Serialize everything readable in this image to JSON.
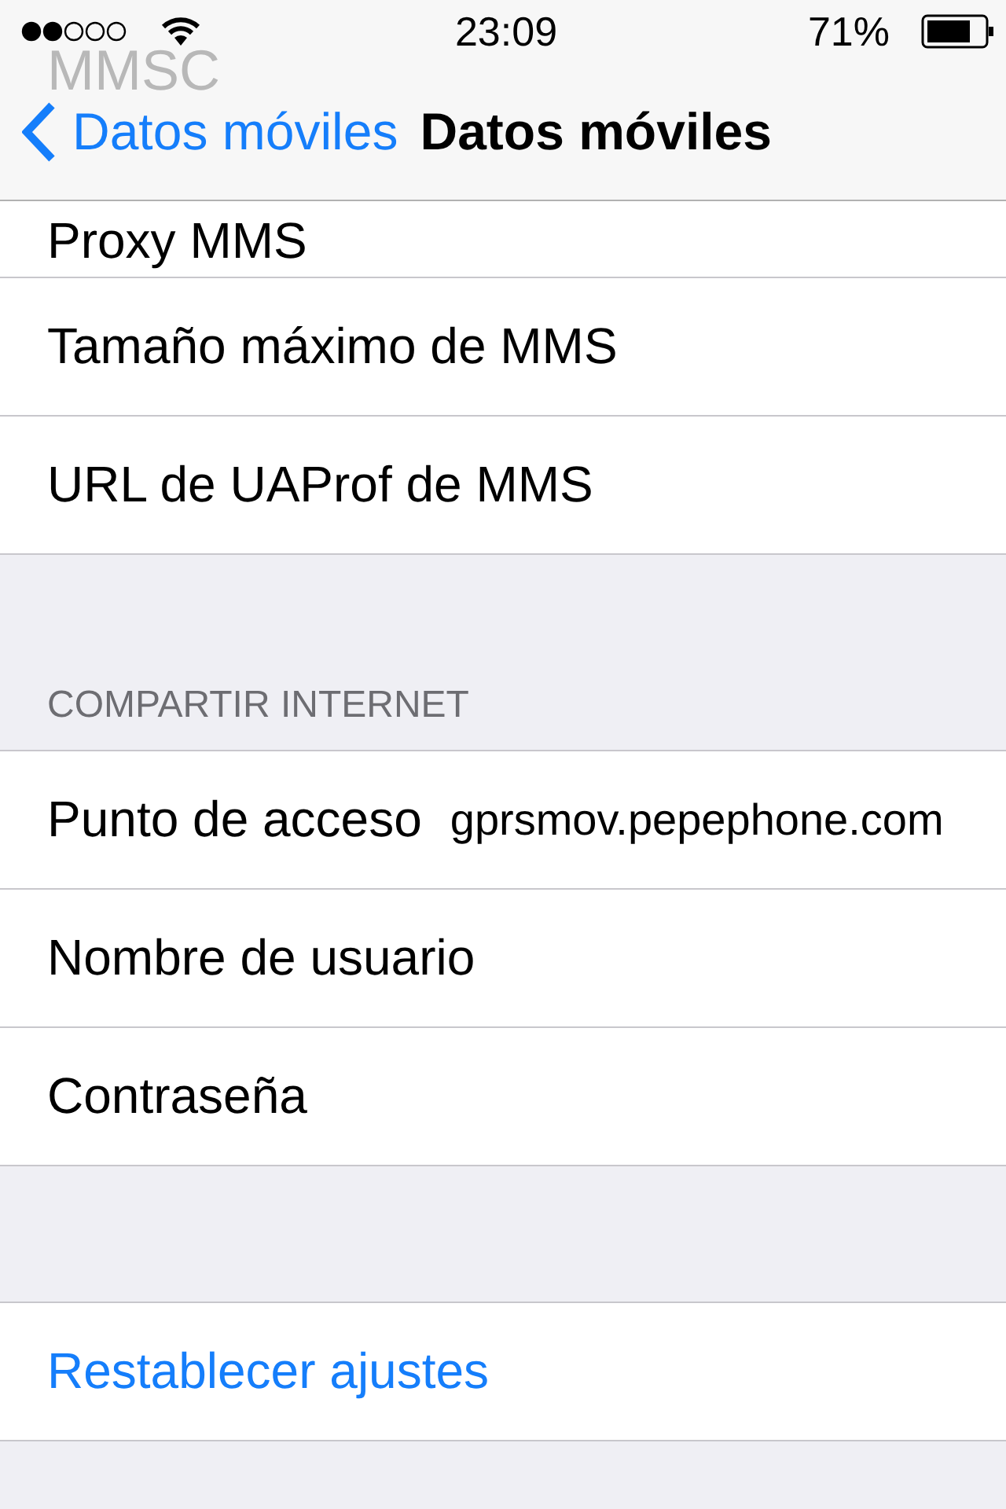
{
  "status_bar": {
    "time": "23:09",
    "battery": "71%"
  },
  "nav_bar": {
    "back": "Datos móviles",
    "title": "Datos móviles",
    "behind_text": "MMSC"
  },
  "sections": [
    {
      "rows": [
        {
          "label": "Proxy MMS",
          "partial": true
        },
        {
          "label": "Tamaño máximo de MMS"
        },
        {
          "label": "URL de UAProf de MMS"
        }
      ]
    },
    {
      "header": "COMPARTIR INTERNET",
      "rows": [
        {
          "label": "Punto de acceso",
          "value": "gprsmov.pepephone.com"
        },
        {
          "label": "Nombre de usuario"
        },
        {
          "label": "Contraseña"
        }
      ]
    },
    {
      "rows": [
        {
          "label": "Restablecer ajustes",
          "kind": "action"
        }
      ]
    }
  ]
}
